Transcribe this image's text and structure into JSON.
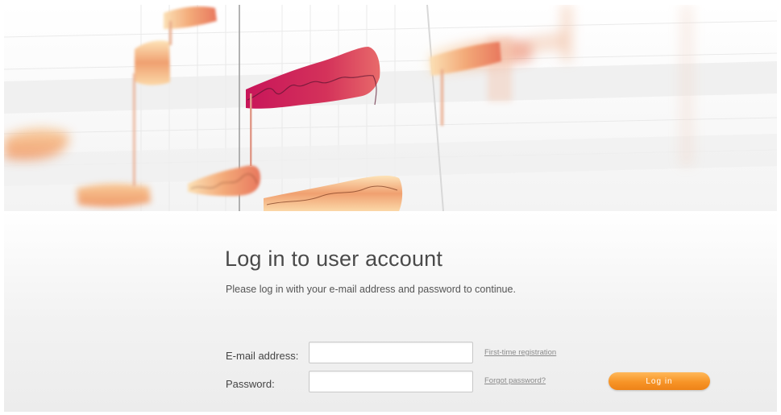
{
  "login": {
    "title": "Log in to user account",
    "subtitle": "Please log in with your e-mail address and password to continue.",
    "email_label": "E-mail address:",
    "email_value": "",
    "password_label": "Password:",
    "password_value": "",
    "first_time_link": "First-time registration",
    "forgot_link": "Forgot password?",
    "login_button": "Log in"
  },
  "colors": {
    "accent": "#f79427",
    "blob_dark": "#c81e5a",
    "blob_light": "#f8c890"
  }
}
